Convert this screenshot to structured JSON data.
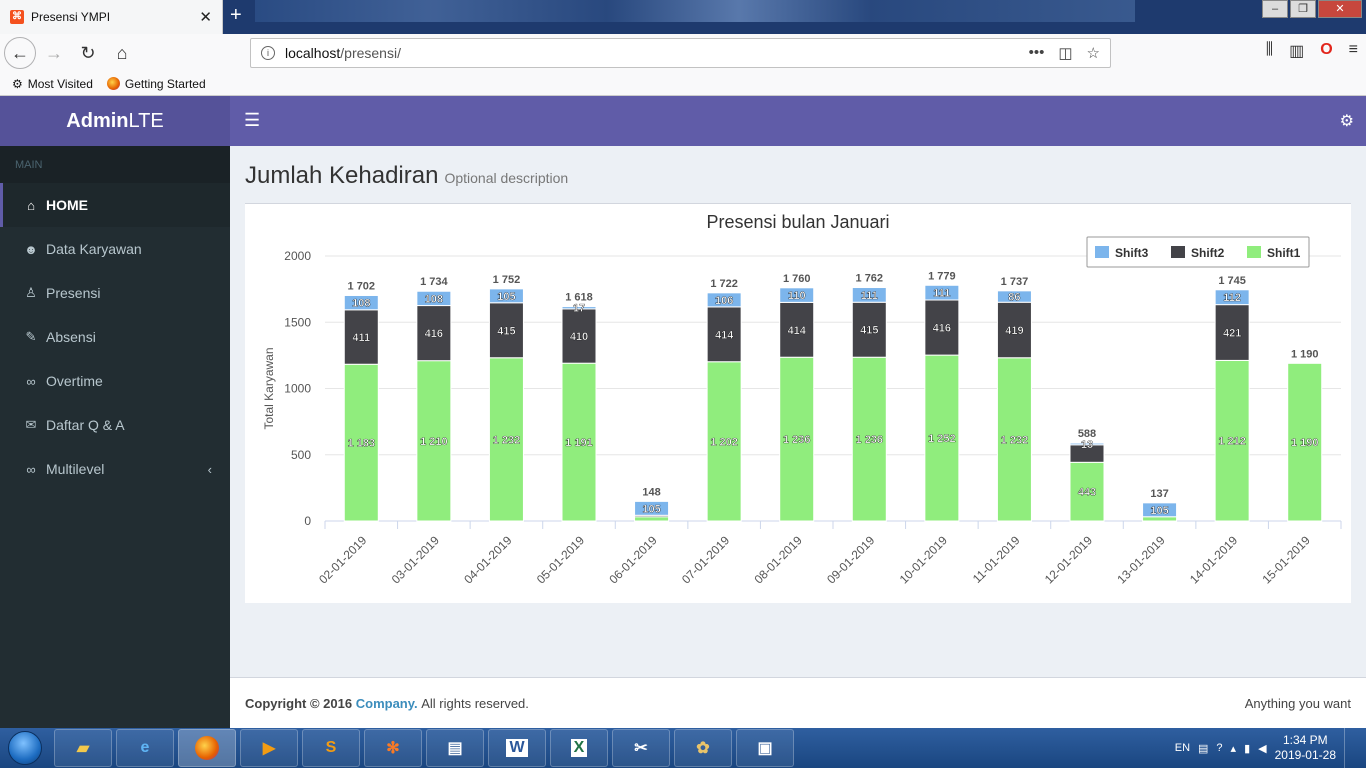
{
  "browser": {
    "tab_title": "Presensi YMPI",
    "url_host": "localhost",
    "url_path": "/presensi/",
    "bookmarks": [
      "Most Visited",
      "Getting Started"
    ]
  },
  "app": {
    "logo_bold": "Admin",
    "logo_light": "LTE",
    "accent_color": "#605ca8"
  },
  "sidebar": {
    "header": "MAIN",
    "items": [
      {
        "label": "HOME",
        "icon": "home-icon"
      },
      {
        "label": "Data Karyawan",
        "icon": "users-icon"
      },
      {
        "label": "Presensi",
        "icon": "male-icon"
      },
      {
        "label": "Absensi",
        "icon": "edit-icon"
      },
      {
        "label": "Overtime",
        "icon": "link-icon"
      },
      {
        "label": "Daftar Q & A",
        "icon": "comments-icon"
      },
      {
        "label": "Multilevel",
        "icon": "link-icon"
      }
    ]
  },
  "page": {
    "title": "Jumlah Kehadiran",
    "description": "Optional description"
  },
  "chart_data": {
    "type": "bar",
    "stacked": true,
    "title": "Presensi bulan Januari",
    "ylabel": "Total Karyawan",
    "xlabel": "",
    "ylim": [
      0,
      2000
    ],
    "yticks": [
      0,
      500,
      1000,
      1500,
      2000
    ],
    "legend_position": "top-right",
    "categories": [
      "02-01-2019",
      "03-01-2019",
      "04-01-2019",
      "05-01-2019",
      "06-01-2019",
      "07-01-2019",
      "08-01-2019",
      "09-01-2019",
      "10-01-2019",
      "11-01-2019",
      "12-01-2019",
      "13-01-2019",
      "14-01-2019",
      "15-01-2019"
    ],
    "series": [
      {
        "name": "Shift1",
        "color": "#90ed7d",
        "values": [
          1183,
          1210,
          1232,
          1191,
          32,
          1202,
          1236,
          1236,
          1252,
          1232,
          443,
          32,
          1212,
          1190
        ]
      },
      {
        "name": "Shift2",
        "color": "#434348",
        "values": [
          411,
          416,
          415,
          410,
          11,
          414,
          414,
          415,
          416,
          419,
          132,
          0,
          421,
          0
        ]
      },
      {
        "name": "Shift3",
        "color": "#7cb5ec",
        "values": [
          108,
          108,
          105,
          17,
          105,
          106,
          110,
          111,
          111,
          86,
          13,
          105,
          112,
          0
        ]
      }
    ],
    "totals": [
      1702,
      1734,
      1752,
      1618,
      148,
      1722,
      1760,
      1762,
      1779,
      1737,
      588,
      137,
      1745,
      1190
    ],
    "data_labels": {
      "Shift1": [
        "1 183",
        "1 210",
        "1 232",
        "1 191",
        "",
        "1 202",
        "1 236",
        "1 236",
        "1 252",
        "1 232",
        "443",
        "",
        "1 212",
        "1 190"
      ],
      "Shift2": [
        "411",
        "416",
        "415",
        "410",
        "",
        "414",
        "414",
        "415",
        "416",
        "419",
        "",
        "",
        "421",
        ""
      ],
      "Shift3": [
        "108",
        "108",
        "105",
        "17",
        "105",
        "106",
        "110",
        "111",
        "111",
        "86",
        "13",
        "105",
        "112",
        ""
      ]
    },
    "total_labels": [
      "1 702",
      "1 734",
      "1 752",
      "1 618",
      "148",
      "1 722",
      "1 760",
      "1 762",
      "1 779",
      "1 737",
      "588",
      "137",
      "1 745",
      "1 190"
    ]
  },
  "footer": {
    "copyright_prefix": "Copyright © 2016",
    "company": "Company.",
    "rights": "All rights reserved.",
    "right_text": "Anything you want"
  },
  "taskbar": {
    "language": "EN",
    "time": "1:34 PM",
    "date": "2019-01-28"
  }
}
